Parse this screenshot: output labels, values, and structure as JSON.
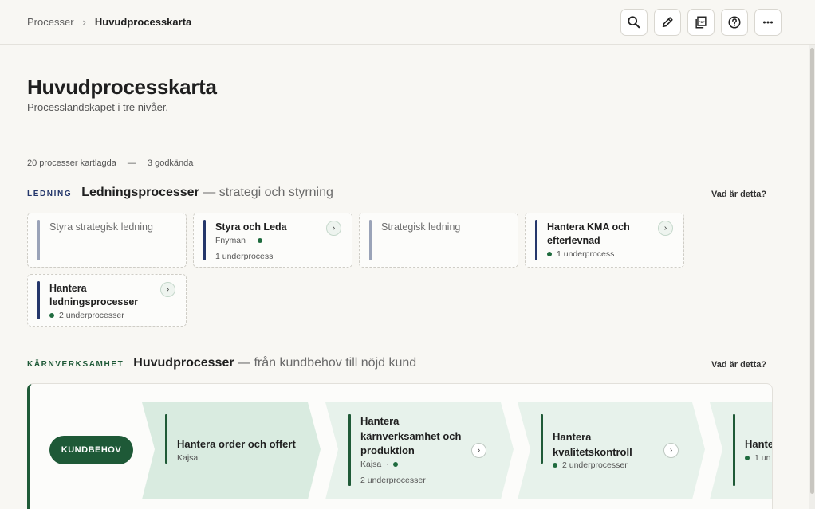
{
  "breadcrumb": {
    "parent": "Processer",
    "separator": "›",
    "current": "Huvudprocesskarta"
  },
  "toolbar": {
    "icons": [
      "search-icon",
      "edit-icon",
      "pdf-icon",
      "help-icon",
      "more-icon"
    ]
  },
  "page": {
    "title": "Huvudprocesskarta",
    "subtitle": "Processlandskapet i tre nivåer."
  },
  "stats": {
    "mapped": "20 processer kartlagda",
    "dash": "—",
    "approved": "3 godkända"
  },
  "sections": {
    "ledning": {
      "tag": "LEDNING",
      "title": "Ledningsprocesser",
      "rest": "— strategi och styrning",
      "help": "Vad är detta?",
      "cards": [
        {
          "title": "Styra strategisk ledning"
        },
        {
          "title": "Styra och Leda",
          "owner": "Fnyman",
          "sub": "1 underprocess"
        },
        {
          "title": "Strategisk ledning"
        },
        {
          "title": "Hantera KMA och efterlevnad",
          "sub": "1 underprocess"
        },
        {
          "title": "Hantera ledningsprocesser",
          "sub": "2 underprocesser"
        }
      ]
    },
    "karn": {
      "tag": "KÄRNVERKSAMHET",
      "title": "Huvudprocesser",
      "rest": "— från kundbehov till nöjd kund",
      "help": "Vad är detta?",
      "start": "KUNDBEHOV",
      "steps": [
        {
          "title": "Hantera order och offert",
          "owner": "Kajsa"
        },
        {
          "title": "Hantera kärnverksamhet och produktion",
          "owner": "Kajsa",
          "sub": "2 underprocesser"
        },
        {
          "title": "Hantera kvalitetskontroll",
          "sub": "2 underprocesser"
        },
        {
          "title": "Hante",
          "sub": "1 un"
        }
      ]
    }
  },
  "colors": {
    "accent_green": "#1e5937",
    "ledning_blue": "#25376b",
    "status_green": "#1f6b3e"
  },
  "chevron_glyph": "›"
}
